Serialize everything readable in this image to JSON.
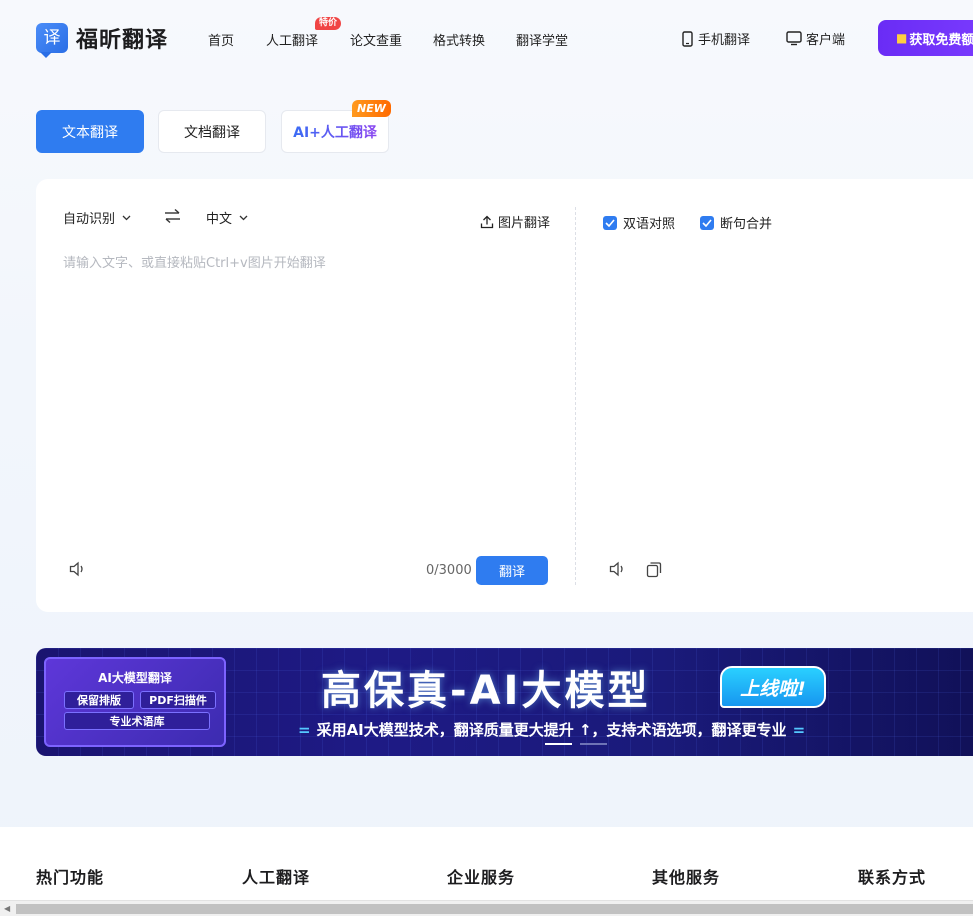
{
  "brand": {
    "logo_glyph": "译",
    "name": "福昕翻译"
  },
  "nav": {
    "items": [
      "首页",
      "人工翻译",
      "论文查重",
      "格式转换",
      "翻译学堂"
    ],
    "badge": "特价"
  },
  "header_links": {
    "mobile": "手机翻译",
    "desktop": "客户端"
  },
  "cta": {
    "label": "获取免费额"
  },
  "tabs": {
    "text": "文本翻译",
    "doc": "文档翻译",
    "ai": "AI+人工翻译",
    "new_badge": "NEW"
  },
  "translator": {
    "source_lang": "自动识别",
    "target_lang": "中文",
    "image_translate": "图片翻译",
    "placeholder": "请输入文字、或直接粘贴Ctrl+v图片开始翻译",
    "char_count": "0/3000",
    "translate_button": "翻译",
    "options": [
      {
        "label": "双语对照",
        "checked": true
      },
      {
        "label": "断句合并",
        "checked": true
      }
    ]
  },
  "banner": {
    "chip_title": "AI大模型翻译",
    "chip_tags": [
      "保留排版",
      "PDF扫描件",
      "专业术语库"
    ],
    "headline": "高保真-AI大模型",
    "live": "上线啦!",
    "subline": "采用AI大模型技术，翻译质量更大提升 ↑，支持术语选项，翻译更专业",
    "active_slide": 1,
    "slide_count": 2
  },
  "footer": {
    "columns": [
      "热门功能",
      "人工翻译",
      "企业服务",
      "其他服务",
      "联系方式"
    ]
  },
  "colors": {
    "primary": "#2f7cf0",
    "cta": "#6a2cf5",
    "badge": "#f04545"
  }
}
